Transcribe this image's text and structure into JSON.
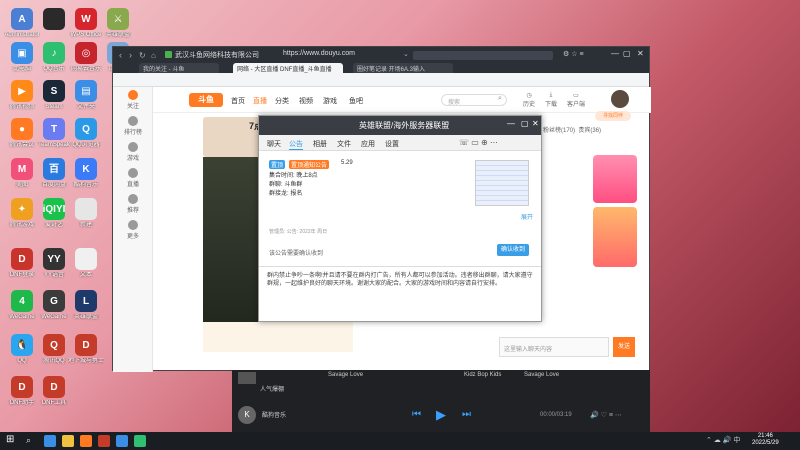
{
  "desktop": {
    "icons": [
      {
        "label": "Administrator",
        "color": "#4a7fd4",
        "glyph": "A"
      },
      {
        "label": "",
        "color": "#2a2a2a",
        "glyph": ""
      },
      {
        "label": "WPS Office",
        "color": "#d6262d",
        "glyph": "W"
      },
      {
        "label": "英雄联盟",
        "color": "#8aa84d",
        "glyph": "⚔"
      },
      {
        "label": "此电脑",
        "color": "#3a8ee6",
        "glyph": "▣"
      },
      {
        "label": "QQ音乐",
        "color": "#2fbf71",
        "glyph": "♪"
      },
      {
        "label": "网易云音乐",
        "color": "#c6242d",
        "glyph": "◎"
      },
      {
        "label": "回收站",
        "color": "#7aa7d8",
        "glyph": "♻"
      },
      {
        "label": "腾讯视频",
        "color": "#ff8a1a",
        "glyph": "▶"
      },
      {
        "label": "Steam",
        "color": "#1b2838",
        "glyph": "S"
      },
      {
        "label": "文件夹",
        "color": "#3a8ee6",
        "glyph": "▤"
      },
      {
        "label": "腾讯会议",
        "color": "#ff7a22",
        "glyph": "●"
      },
      {
        "label": "TeamSpeak",
        "color": "#6a7cf0",
        "glyph": "T"
      },
      {
        "label": "QQ浏览器",
        "color": "#2a9ae8",
        "glyph": "Q"
      },
      {
        "label": "美图",
        "color": "#f0507a",
        "glyph": "M"
      },
      {
        "label": "百度网盘",
        "color": "#2a7be0",
        "glyph": "百"
      },
      {
        "label": "酷狗音乐",
        "color": "#3b7bf7",
        "glyph": "K"
      },
      {
        "label": "腾讯游戏",
        "color": "#f0a020",
        "glyph": "✦"
      },
      {
        "label": "爱奇艺",
        "color": "#19c24b",
        "glyph": "iQIYI"
      },
      {
        "label": "新建",
        "color": "#e6e6e6",
        "glyph": ""
      },
      {
        "label": "DNF登录",
        "color": "#c9342a",
        "glyph": "D"
      },
      {
        "label": "YY语音",
        "color": "#333",
        "glyph": "YY"
      },
      {
        "label": "文本",
        "color": "#f0f0f0",
        "glyph": ""
      },
      {
        "label": "WeGame",
        "color": "#1fb84a",
        "glyph": "4"
      },
      {
        "label": "WeGame",
        "color": "#3b3b3b",
        "glyph": "G"
      },
      {
        "label": "英雄联盟",
        "color": "#1d3a6a",
        "glyph": "L"
      },
      {
        "label": "QQ",
        "color": "#2aa5f0",
        "glyph": "🐧"
      },
      {
        "label": "腾讯QQ",
        "color": "#c53b2a",
        "glyph": "Q"
      },
      {
        "label": "地下城与勇士",
        "color": "#c53b2a",
        "glyph": "D"
      },
      {
        "label": "DNF助手",
        "color": "#c53b2a",
        "glyph": "D"
      },
      {
        "label": "DNF工具",
        "color": "#c53b2a",
        "glyph": "D"
      }
    ]
  },
  "browser": {
    "title": "武汉斗鱼网络科技有限公司",
    "url": "https://www.douyu.com",
    "tabs": [
      "我的关注 - 斗鱼",
      "网络 - 大区直播 DNF直播_斗鱼直播",
      "圈好笔记录 开场6A.3输入"
    ],
    "side_items": [
      "关注",
      "排行榜",
      "游戏",
      "直播",
      "推荐",
      "更多"
    ],
    "site_nav": [
      "首页",
      "直播",
      "分类",
      "视频",
      "游戏",
      "鱼吧"
    ],
    "search_placeholder": "搜索",
    "header_icons": [
      "历史",
      "下载",
      "客户端"
    ],
    "stream_title": "7点",
    "chat_input_placeholder": "这里输入聊天内容",
    "send_label": "发送",
    "right_tabs": [
      "粉丝榜(170)",
      "贵宾(36)"
    ],
    "promo": "寻找同伴"
  },
  "chat_window": {
    "title": "英雄联盟/海外服务器联盟",
    "tabs": [
      "聊天",
      "公告",
      "相册",
      "文件",
      "应用",
      "设置"
    ],
    "notice_tags": [
      "置顶",
      "置顶通知公告"
    ],
    "notice_date": "5.29",
    "notice_lines": [
      "集合时间: 晚上8点",
      "群聊: 斗鱼群",
      "群接龙: 报名"
    ],
    "notice_footer": "管理员:   公告:   2022年  周日",
    "notice_confirm": "确认收到",
    "input_hint": "该公告需要确认收到",
    "message": "群内禁止争吵一条啊!并且请不要在群内打广告，所有人都可以参加活动。违者移出群聊，请大家遵守群规，一起维护良好的聊天环境。谢谢大家的配合。大家的游戏时间和内容请自行安排。"
  },
  "player": {
    "app": "酷狗音乐",
    "tracks": [
      {
        "title": "Savage Love",
        "artist": "Kidz Bop Kids",
        "album": "Savage Love"
      },
      {
        "title": "人气爆棚",
        "artist": "",
        "album": "人气爆棚"
      }
    ],
    "time": "00:00/03:19"
  },
  "taskbar": {
    "time": "21:46",
    "date": "2022/5/29"
  },
  "colors": {
    "douyu_orange": "#ff7a22",
    "chat_head": "#3a3d44",
    "tag_blue": "#3a9ee6",
    "send_orange": "#ff7a22"
  }
}
